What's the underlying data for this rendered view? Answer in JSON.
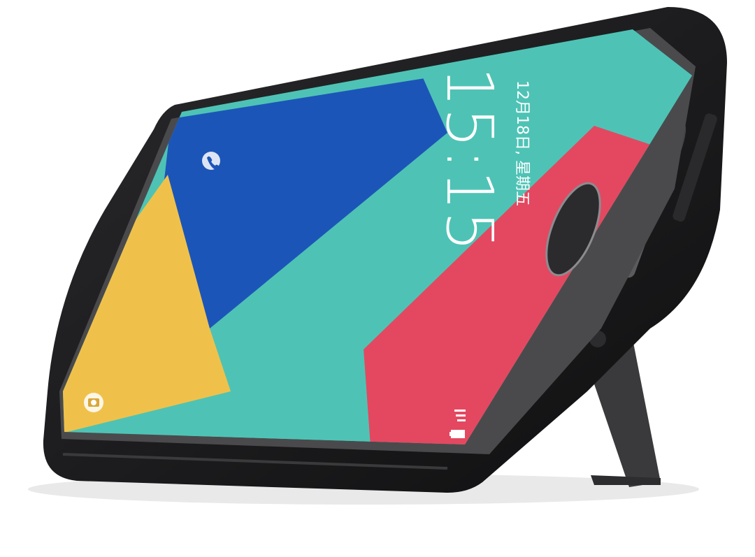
{
  "lockscreen": {
    "time": "15:15",
    "date": "12月18日, 星期五",
    "phone_shortcut_icon": "phone-icon",
    "camera_shortcut_icon": "camera-icon",
    "status_icons": [
      "signal-icon",
      "battery-icon"
    ]
  },
  "colors": {
    "case": "#1c1c1e",
    "case_edge": "#2e2e31",
    "bezel": "#4a4a4c",
    "wallpaper_blue": "#1c55b8",
    "wallpaper_teal": "#4ec3b5",
    "wallpaper_yellow": "#f0c14a",
    "wallpaper_red": "#e34860",
    "kickstand": "#3a3a3c"
  }
}
